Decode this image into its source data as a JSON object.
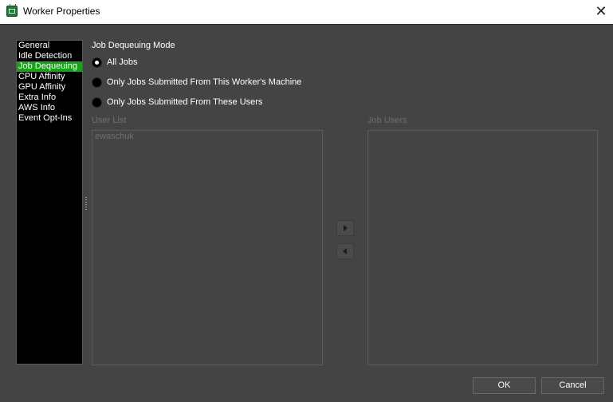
{
  "window": {
    "title": "Worker Properties",
    "close_symbol": "✕"
  },
  "sidebar": {
    "items": [
      {
        "label": "General",
        "selected": false
      },
      {
        "label": "Idle Detection",
        "selected": false
      },
      {
        "label": "Job Dequeuing",
        "selected": true
      },
      {
        "label": "CPU Affinity",
        "selected": false
      },
      {
        "label": "GPU Affinity",
        "selected": false
      },
      {
        "label": "Extra Info",
        "selected": false
      },
      {
        "label": "AWS Info",
        "selected": false
      },
      {
        "label": "Event Opt-Ins",
        "selected": false
      }
    ]
  },
  "dequeuing": {
    "mode_title": "Job Dequeuing Mode",
    "options": [
      {
        "label": "All Jobs",
        "checked": true
      },
      {
        "label": "Only Jobs Submitted From This Worker's Machine",
        "checked": false
      },
      {
        "label": "Only Jobs Submitted From These Users",
        "checked": false
      }
    ]
  },
  "user_list": {
    "label": "User List",
    "items": [
      "ewaschuk"
    ]
  },
  "job_users": {
    "label": "Job Users",
    "items": []
  },
  "buttons": {
    "ok": "OK",
    "cancel": "Cancel"
  },
  "colors": {
    "accent": "#16a316",
    "background": "#444444",
    "sidebar_bg": "#000000",
    "disabled_text": "#6e6e6e"
  }
}
